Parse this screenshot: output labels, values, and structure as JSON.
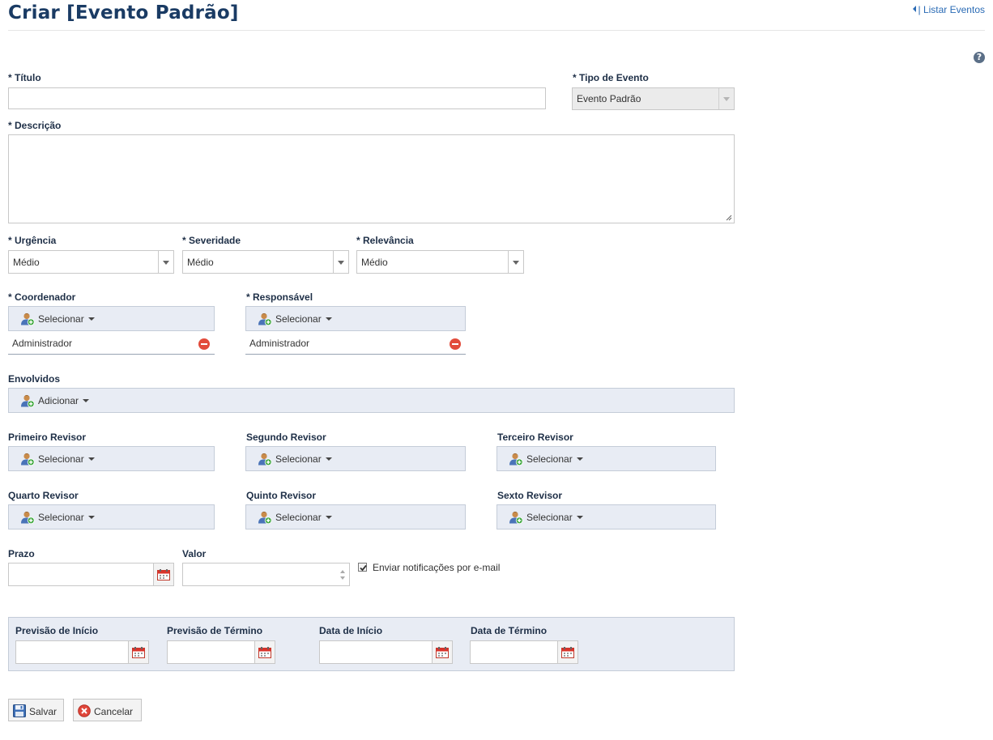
{
  "header": {
    "title": "Criar [Evento Padrão]",
    "list_link": "| Listar Eventos",
    "help": "?"
  },
  "form": {
    "titulo": {
      "label": "* Título",
      "value": ""
    },
    "tipo_evento": {
      "label": "* Tipo de Evento",
      "value": "Evento Padrão"
    },
    "descricao": {
      "label": "* Descrição",
      "value": ""
    },
    "urgencia": {
      "label": "* Urgência",
      "value": "Médio"
    },
    "severidade": {
      "label": "* Severidade",
      "value": "Médio"
    },
    "relevancia": {
      "label": "* Relevância",
      "value": "Médio"
    },
    "coordenador": {
      "label": "* Coordenador",
      "button": "Selecionar",
      "selected": "Administrador"
    },
    "responsavel": {
      "label": "* Responsável",
      "button": "Selecionar",
      "selected": "Administrador"
    },
    "envolvidos": {
      "label": "Envolvidos",
      "button": "Adicionar"
    },
    "revisores": [
      {
        "label": "Primeiro Revisor",
        "button": "Selecionar"
      },
      {
        "label": "Segundo Revisor",
        "button": "Selecionar"
      },
      {
        "label": "Terceiro Revisor",
        "button": "Selecionar"
      },
      {
        "label": "Quarto Revisor",
        "button": "Selecionar"
      },
      {
        "label": "Quinto Revisor",
        "button": "Selecionar"
      },
      {
        "label": "Sexto Revisor",
        "button": "Selecionar"
      }
    ],
    "prazo": {
      "label": "Prazo",
      "value": ""
    },
    "valor": {
      "label": "Valor",
      "value": ""
    },
    "notificacoes": {
      "label": "Enviar notificações por e-mail",
      "checked": true
    },
    "datas": {
      "previsao_inicio": "Previsão de Início",
      "previsao_termino": "Previsão de Término",
      "data_inicio": "Data de Início",
      "data_termino": "Data de Término"
    }
  },
  "actions": {
    "save": "Salvar",
    "cancel": "Cancelar"
  },
  "colors": {
    "title": "#1a3b64",
    "link": "#2a6bb5",
    "label": "#1e2f47",
    "panel_bg": "#e8ecf4",
    "remove": "#e24b3b"
  },
  "icons": {
    "user_add": "user-add-icon",
    "calendar": "calendar-icon",
    "remove": "remove-icon",
    "save": "floppy-disk-icon",
    "cancel": "cancel-icon",
    "help": "help-icon"
  }
}
